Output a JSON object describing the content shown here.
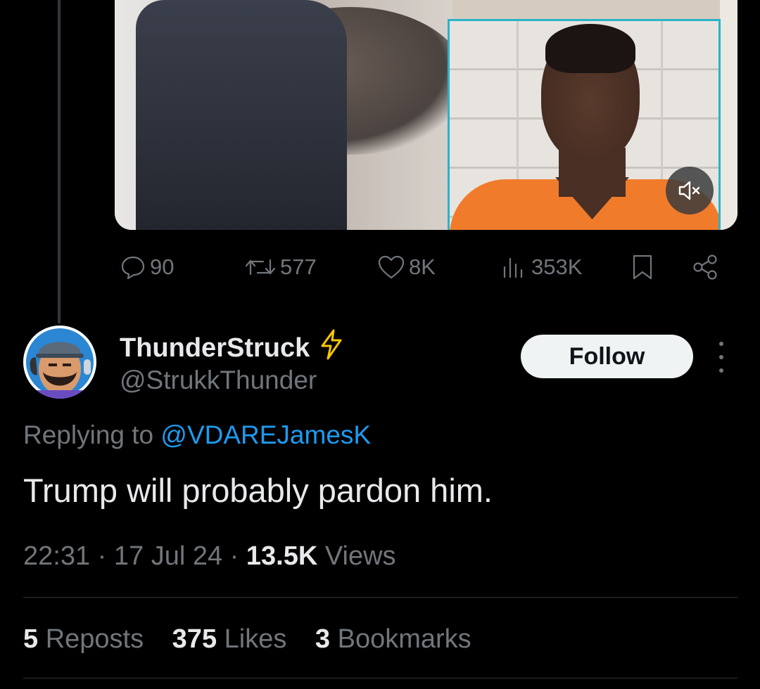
{
  "media": {
    "mute_icon": "volume-mute-icon"
  },
  "actions": {
    "reply_count": "90",
    "repost_count": "577",
    "like_count": "8K",
    "views_count": "353K",
    "icons": [
      "reply-icon",
      "repost-icon",
      "like-icon",
      "views-icon",
      "bookmark-icon",
      "share-icon"
    ]
  },
  "reply": {
    "display_name": "ThunderStruck",
    "handle": "@StrukkThunder",
    "follow_label": "Follow",
    "replying_prefix": "Replying to",
    "replying_to": "@VDAREJamesK",
    "text": "Trump will probably pardon him.",
    "time": "22:31",
    "separator": "·",
    "date": "17 Jul 24",
    "views_count": "13.5K",
    "views_label": "Views",
    "reposts_count": "5",
    "reposts_label": "Reposts",
    "likes_count": "375",
    "likes_label": "Likes",
    "bookmarks_count": "3",
    "bookmarks_label": "Bookmarks"
  },
  "colors": {
    "background": "#000000",
    "text_primary": "#e7e9ea",
    "text_secondary": "#71767b",
    "accent_link": "#1d9bf0",
    "divider": "#2f3336",
    "bolt": "#f7c600"
  }
}
